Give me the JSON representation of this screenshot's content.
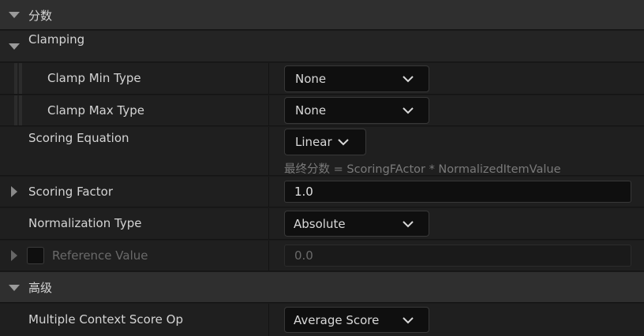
{
  "sections": {
    "score": {
      "title": "分数"
    },
    "advanced": {
      "title": "高级"
    }
  },
  "clamping": {
    "title": "Clamping",
    "clamp_min_type": {
      "label": "Clamp Min Type",
      "value": "None"
    },
    "clamp_max_type": {
      "label": "Clamp Max Type",
      "value": "None"
    }
  },
  "scoring_equation": {
    "label": "Scoring Equation",
    "value": "Linear",
    "formula": "最终分数 = ScoringFActor * NormalizedItemValue"
  },
  "scoring_factor": {
    "label": "Scoring Factor",
    "value": "1.0"
  },
  "normalization_type": {
    "label": "Normalization Type",
    "value": "Absolute"
  },
  "reference_value": {
    "label": "Reference Value",
    "value": "0.0"
  },
  "multiple_context_score_op": {
    "label": "Multiple Context Score Op",
    "value": "Average Score"
  },
  "icons": {
    "collapse": "caret-down-icon",
    "expand": "caret-right-icon",
    "dropdown": "chevron-down-icon"
  },
  "colors": {
    "background": "#1a1a1a",
    "section_header": "#2f2f2f",
    "input_bg": "#0f0f0f",
    "text": "#d4d4d4",
    "disabled_text": "#6a6a6a"
  }
}
